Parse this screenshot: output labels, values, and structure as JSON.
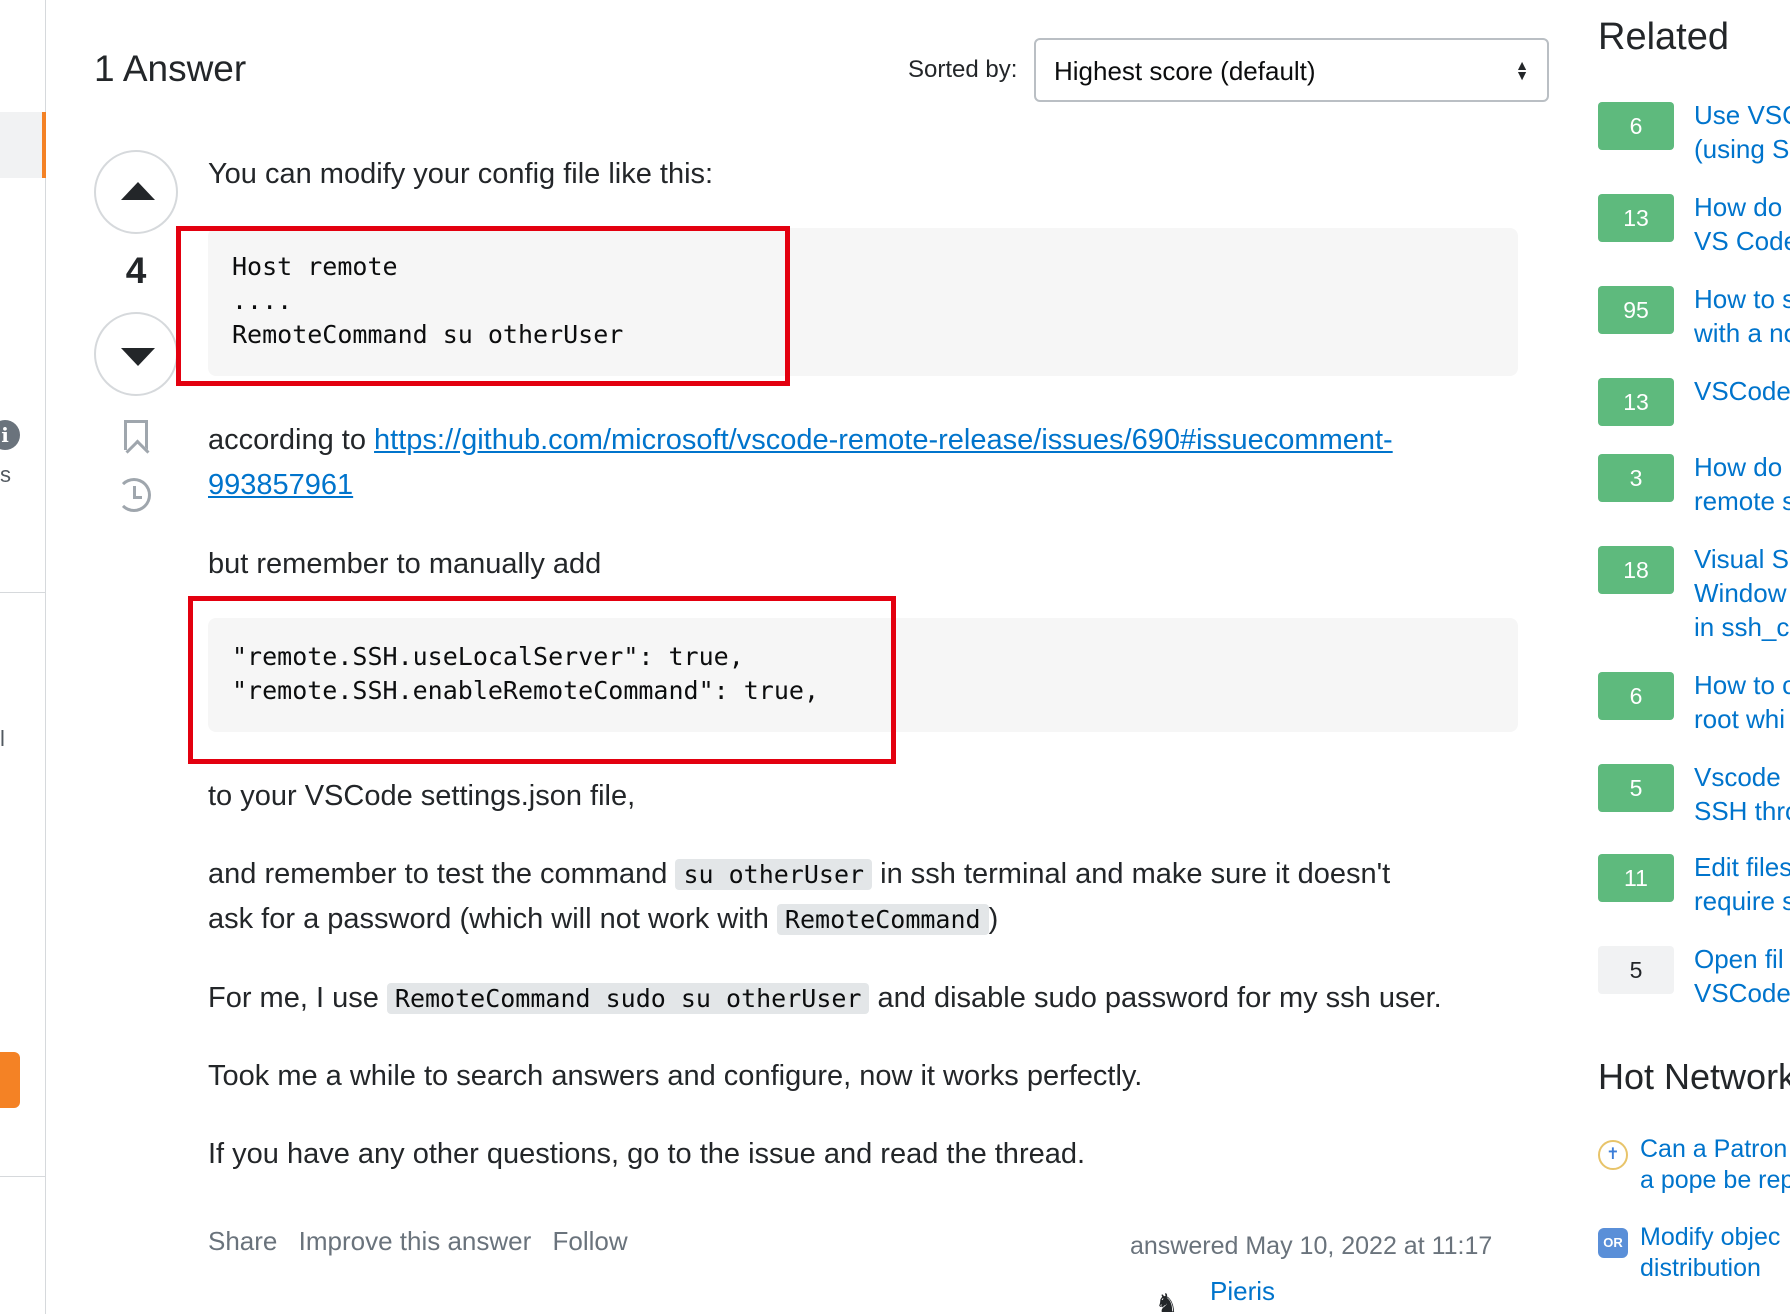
{
  "left_sidebar": {
    "fragment_s": "s",
    "fragment_l": "l"
  },
  "answers": {
    "title": "1 Answer",
    "sort_label": "Sorted by:",
    "sort_value": "Highest score (default)"
  },
  "answer": {
    "score": "4",
    "intro": "You can modify your config file like this:",
    "code1_lines": [
      "Host remote",
      "....",
      "RemoteCommand su otherUser"
    ],
    "according_prefix": "according to ",
    "link_text_1": "https://github.com/microsoft/vscode-remote-release/issues/690#issuecomment-",
    "link_text_2": "993857961",
    "remember_add": "but remember to manually add",
    "code2_lines": [
      "\"remote.SSH.useLocalServer\": true,",
      "\"remote.SSH.enableRemoteCommand\": true,"
    ],
    "settings_text": "to your VSCode settings.json file,",
    "test_prefix": "and remember to test the command ",
    "test_code": "su otherUser",
    "test_suffix": " in ssh terminal and make sure it doesn't",
    "password_prefix": "ask for a password (which will not work with ",
    "password_code": "RemoteCommand",
    "password_suffix": ")",
    "forme_prefix": "For me, I use ",
    "forme_code": "RemoteCommand sudo su otherUser",
    "forme_suffix": " and disable sudo password for my ssh user.",
    "took_text": "Took me a while to search answers and configure, now it works perfectly.",
    "questions_text": "If you have any other questions, go to the issue and read the thread.",
    "menu": {
      "share": "Share",
      "improve": "Improve this answer",
      "follow": "Follow"
    },
    "answered_label": "answered ",
    "answered_time": "May 10, 2022 at 11:17",
    "user_name": "Pieris"
  },
  "related": {
    "title": "Related",
    "items": [
      {
        "score": "6",
        "line1": "Use VSC",
        "line2": "(using S",
        "accepted": true
      },
      {
        "score": "13",
        "line1": "How do",
        "line2": "VS Code",
        "accepted": true
      },
      {
        "score": "95",
        "line1": "How to s",
        "line2": "with a no",
        "accepted": true
      },
      {
        "score": "13",
        "line1": "VSCode",
        "line2": "",
        "accepted": true
      },
      {
        "score": "3",
        "line1": "How do",
        "line2": "remote s",
        "accepted": true
      },
      {
        "score": "18",
        "line1": "Visual S",
        "line2": "Window",
        "line3": "in ssh_c",
        "accepted": true
      },
      {
        "score": "6",
        "line1": "How to c",
        "line2": "root whi",
        "accepted": true
      },
      {
        "score": "5",
        "line1": "Vscode",
        "line2": "SSH thro",
        "accepted": true
      },
      {
        "score": "11",
        "line1": "Edit files",
        "line2": "require s",
        "accepted": true
      },
      {
        "score": "5",
        "line1": "Open fil",
        "line2": "VSCode",
        "accepted": false
      }
    ]
  },
  "hot_network": {
    "title": "Hot Network",
    "items": [
      {
        "icon": "christianity-icon",
        "line1": "Can a Patron",
        "line2": "a pope be rep"
      },
      {
        "icon": "or-icon",
        "icon_label": "OR",
        "line1": "Modify objec",
        "line2": "distribution"
      }
    ]
  },
  "colors": {
    "accent_orange": "#f48225",
    "link_blue": "#0074cc",
    "accepted_green": "#5eba7d",
    "highlight_red": "#e3000f"
  }
}
